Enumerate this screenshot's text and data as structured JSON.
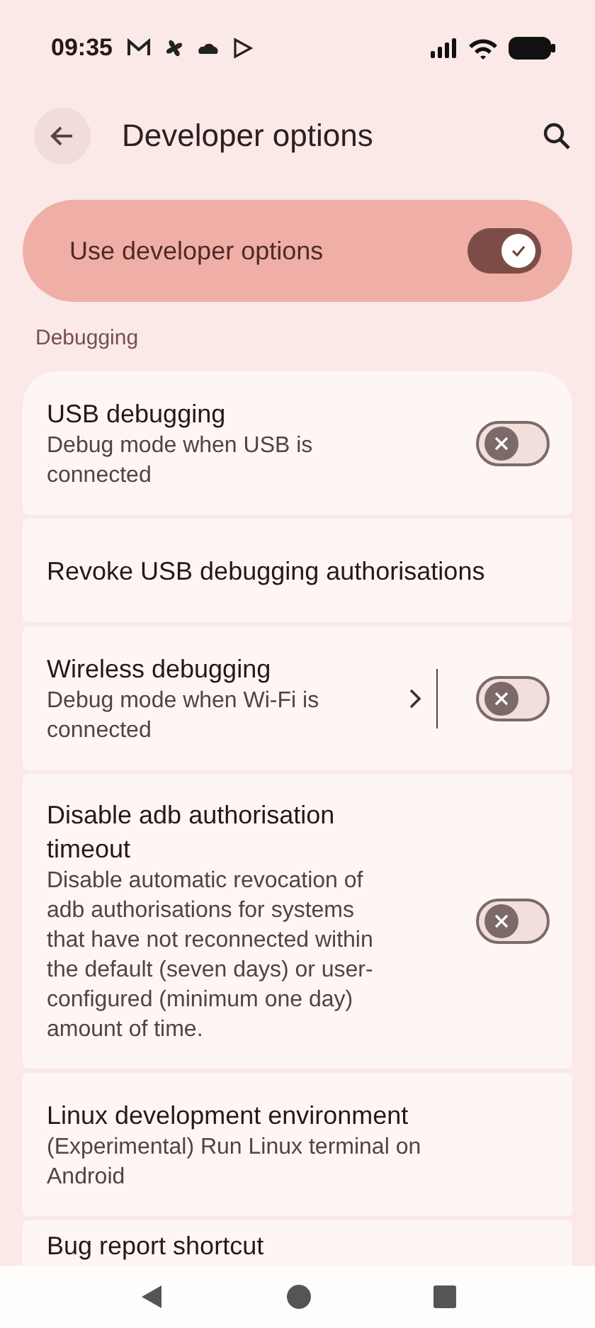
{
  "status_bar": {
    "time": "09:35"
  },
  "header": {
    "title": "Developer options"
  },
  "master_switch": {
    "label": "Use developer options",
    "on": true
  },
  "section": {
    "title": "Debugging"
  },
  "items": [
    {
      "kind": "switch",
      "title": "USB debugging",
      "subtitle": "Debug mode when USB is connected",
      "on": false
    },
    {
      "kind": "link",
      "title": "Revoke USB debugging authorisations"
    },
    {
      "kind": "link_switch",
      "title": "Wireless debugging",
      "subtitle": "Debug mode when Wi-Fi is connected",
      "on": false
    },
    {
      "kind": "switch",
      "title": "Disable adb authorisation timeout",
      "subtitle": "Disable automatic revocation of adb authorisations for systems that have not reconnected within the default (seven days) or user-configured (minimum one day) amount of time.",
      "on": false
    },
    {
      "kind": "link",
      "title": "Linux development environment",
      "subtitle": "(Experimental) Run Linux terminal on Android"
    },
    {
      "kind": "link",
      "title": "Bug report shortcut"
    }
  ]
}
